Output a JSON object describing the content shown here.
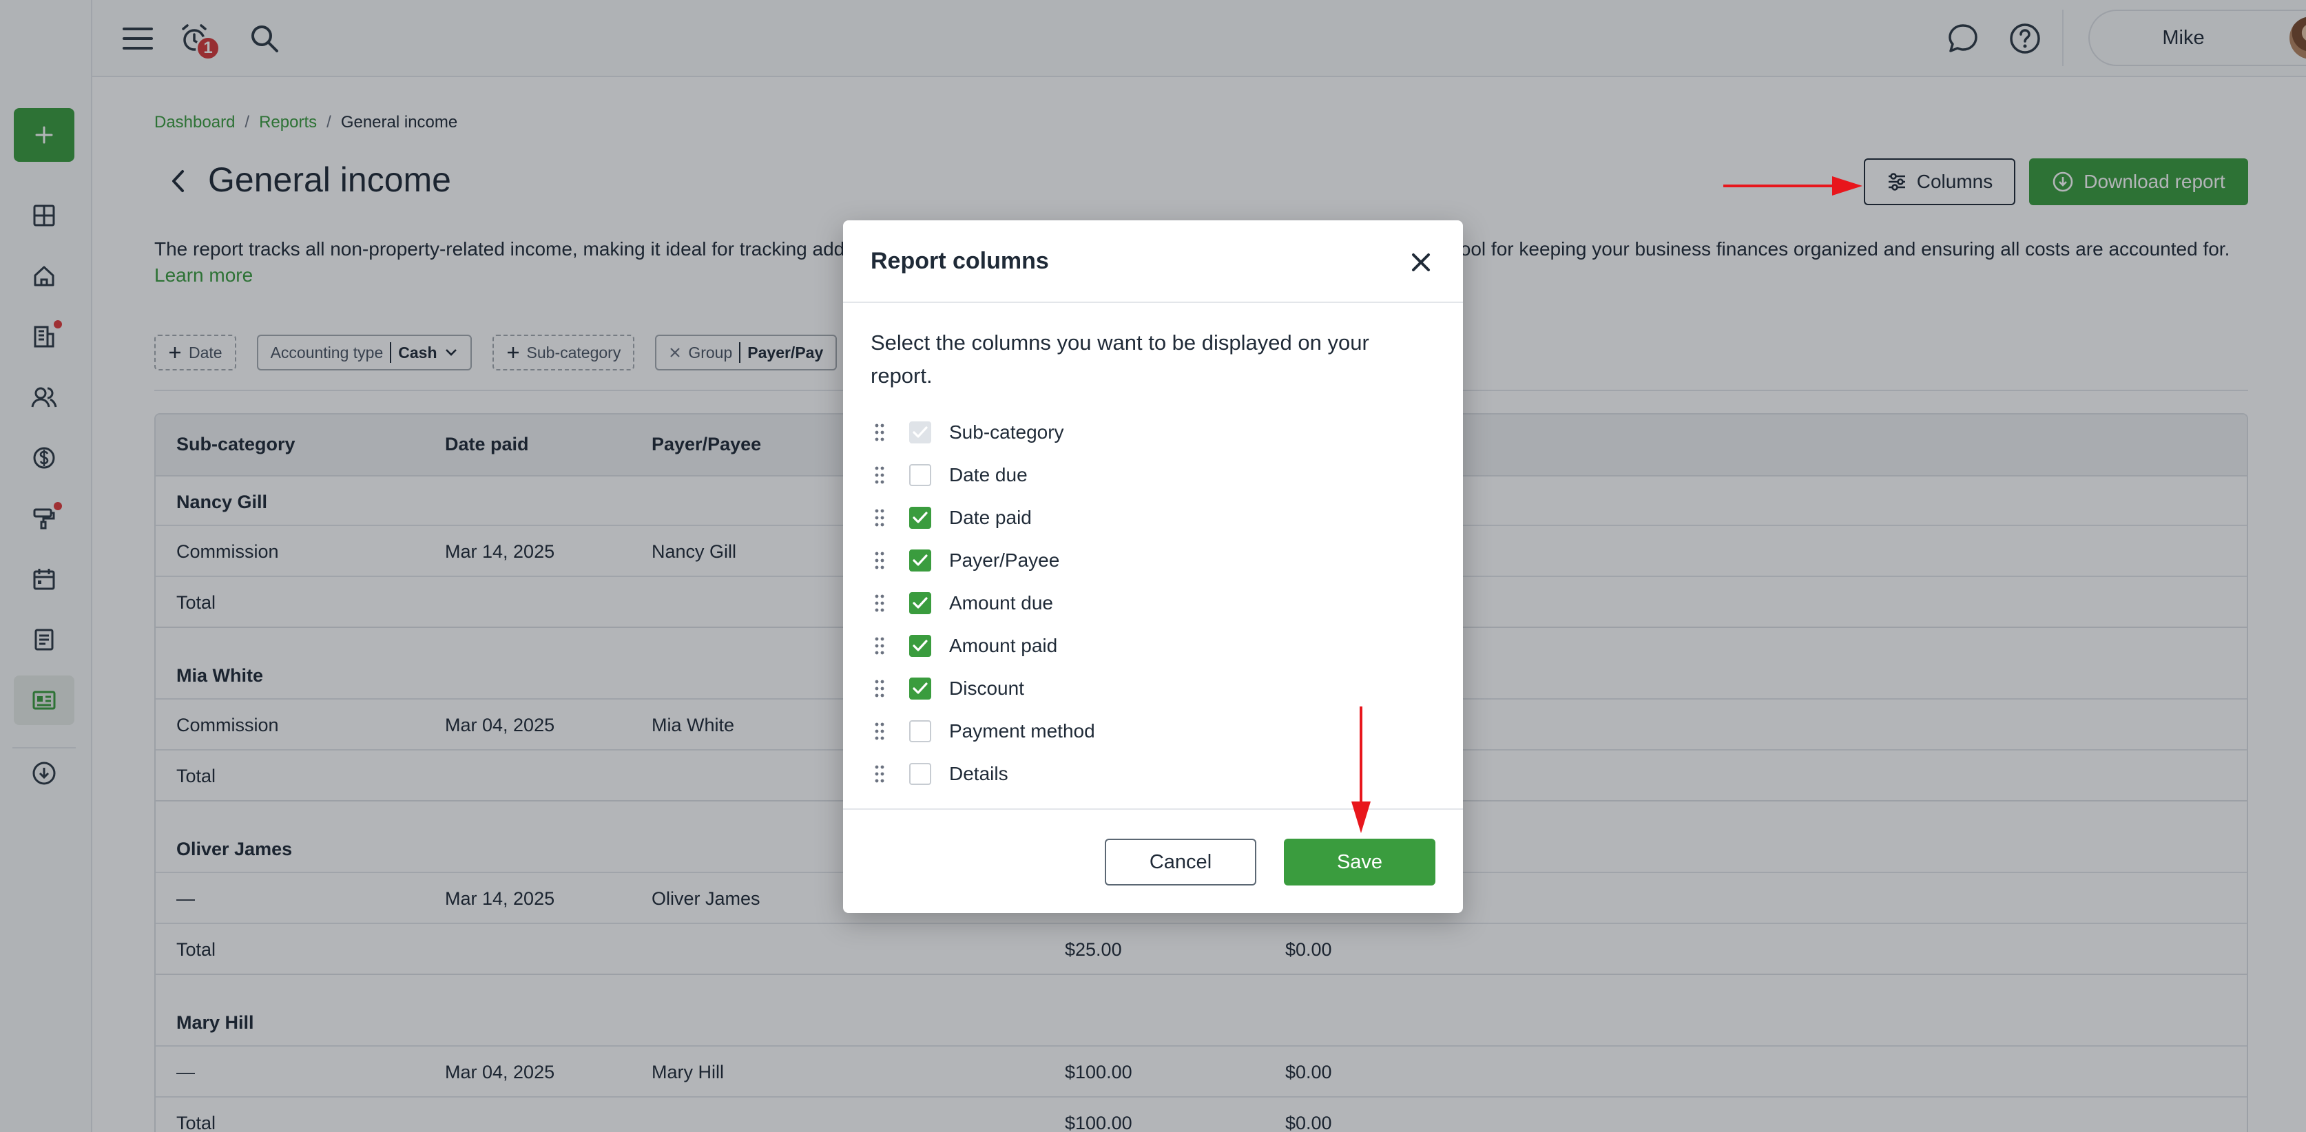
{
  "topbar": {
    "notification_count": "1",
    "user_name": "Mike"
  },
  "sidebar": {
    "items": [
      {
        "name": "dashboard",
        "icon": "grid-icon"
      },
      {
        "name": "properties",
        "icon": "home-icon"
      },
      {
        "name": "leasing",
        "icon": "document-building-icon",
        "has_dot": true
      },
      {
        "name": "people",
        "icon": "users-icon"
      },
      {
        "name": "accounting",
        "icon": "dollar-icon"
      },
      {
        "name": "maintenance",
        "icon": "paint-roller-icon",
        "has_dot": true
      },
      {
        "name": "calendar",
        "icon": "calendar-icon"
      },
      {
        "name": "documents",
        "icon": "notes-icon"
      },
      {
        "name": "reports",
        "icon": "report-icon",
        "active": true
      },
      {
        "name": "downloads",
        "icon": "cloud-download-icon"
      }
    ]
  },
  "breadcrumb": {
    "items": [
      "Dashboard",
      "Reports"
    ],
    "current": "General income",
    "separator": "/"
  },
  "page": {
    "title": "General income",
    "columns_label": "Columns",
    "download_label": "Download report",
    "description": "The report tracks all non-property-related income, making it ideal for tracking addi",
    "description_tail": "tool for keeping your business finances organized and ensuring all costs are accounted for.",
    "learn_more": "Learn more"
  },
  "filters": [
    {
      "label": "Date",
      "type": "add"
    },
    {
      "label": "Accounting type",
      "value": "Cash",
      "type": "select"
    },
    {
      "label": "Sub-category",
      "type": "add"
    },
    {
      "label": "Group",
      "value": "Payer/Pay",
      "type": "remove"
    }
  ],
  "table": {
    "headers": [
      "Sub-category",
      "Date paid",
      "Payer/Payee"
    ],
    "rows": [
      {
        "kind": "group",
        "cells": [
          "Nancy Gill"
        ]
      },
      {
        "kind": "data",
        "cells": [
          "Commission",
          "Mar 14, 2025",
          "Nancy Gill",
          "",
          ""
        ]
      },
      {
        "kind": "total",
        "cells": [
          "Total",
          "",
          "",
          "",
          ""
        ]
      },
      {
        "kind": "group",
        "cells": [
          "Mia White"
        ]
      },
      {
        "kind": "data",
        "cells": [
          "Commission",
          "Mar 04, 2025",
          "Mia White",
          "",
          ""
        ]
      },
      {
        "kind": "total",
        "cells": [
          "Total",
          "",
          "",
          "",
          ""
        ]
      },
      {
        "kind": "group",
        "cells": [
          "Oliver James"
        ]
      },
      {
        "kind": "data",
        "cells": [
          "—",
          "Mar 14, 2025",
          "Oliver James",
          "",
          ""
        ]
      },
      {
        "kind": "total",
        "cells": [
          "Total",
          "",
          "",
          "$25.00",
          "$0.00"
        ]
      },
      {
        "kind": "group",
        "cells": [
          "Mary Hill"
        ]
      },
      {
        "kind": "data",
        "cells": [
          "—",
          "Mar 04, 2025",
          "Mary Hill",
          "$100.00",
          "$0.00"
        ]
      },
      {
        "kind": "total",
        "cells": [
          "Total",
          "",
          "",
          "$100.00",
          "$0.00"
        ]
      }
    ]
  },
  "modal": {
    "title": "Report columns",
    "description": "Select the columns you want to be displayed on your report.",
    "columns": [
      {
        "label": "Sub-category",
        "state": "disabled"
      },
      {
        "label": "Date due",
        "state": "unchecked"
      },
      {
        "label": "Date paid",
        "state": "checked"
      },
      {
        "label": "Payer/Payee",
        "state": "checked"
      },
      {
        "label": "Amount due",
        "state": "checked"
      },
      {
        "label": "Amount paid",
        "state": "checked"
      },
      {
        "label": "Discount",
        "state": "checked"
      },
      {
        "label": "Payment method",
        "state": "unchecked"
      },
      {
        "label": "Details",
        "state": "unchecked"
      }
    ],
    "cancel_label": "Cancel",
    "save_label": "Save"
  },
  "colors": {
    "brand_green": "#3a9c3e",
    "annotation_red": "#e8161c",
    "badge_red": "#d6393a"
  }
}
